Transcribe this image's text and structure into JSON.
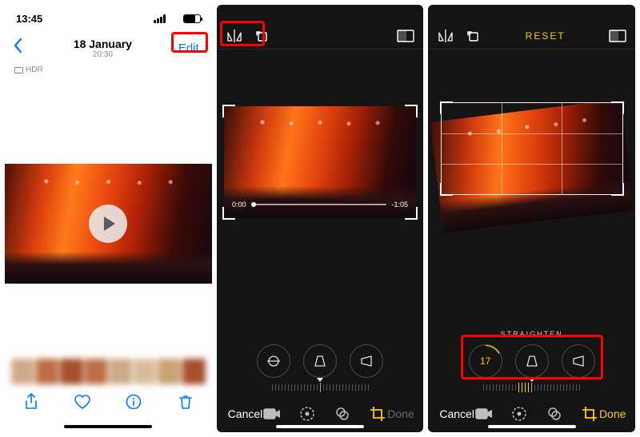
{
  "panel1": {
    "status_time": "13:45",
    "nav_date": "18 January",
    "nav_time": "20:30",
    "edit_label": "Edit",
    "hdr_label": "HDR",
    "toolbar": {
      "share": "share-icon",
      "favorite": "heart-icon",
      "info": "info-icon",
      "delete": "trash-icon"
    }
  },
  "panel2": {
    "scrub_start": "0:00",
    "scrub_end": "-1:05",
    "cancel_label": "Cancel",
    "done_label": "Done",
    "top_icons": {
      "flip": "flip-horizontal-icon",
      "rotate": "rotate-icon",
      "aspect": "aspect-icon"
    },
    "mode_icons": {
      "video": "video-icon",
      "adjust": "adjust-icon",
      "filters": "filters-icon",
      "crop": "crop-icon"
    }
  },
  "panel3": {
    "reset_label": "RESET",
    "adjust_label": "STRAIGHTEN",
    "straighten_value": "17",
    "cancel_label": "Cancel",
    "done_label": "Done",
    "top_icons": {
      "flip": "flip-horizontal-icon",
      "rotate": "rotate-icon",
      "aspect": "aspect-icon"
    },
    "mode_icons": {
      "video": "video-icon",
      "adjust": "adjust-icon",
      "filters": "filters-icon",
      "crop": "crop-icon"
    },
    "adjust_buttons": {
      "straighten": "straighten-icon",
      "vertical": "perspective-v-icon",
      "horizontal": "perspective-h-icon"
    }
  }
}
